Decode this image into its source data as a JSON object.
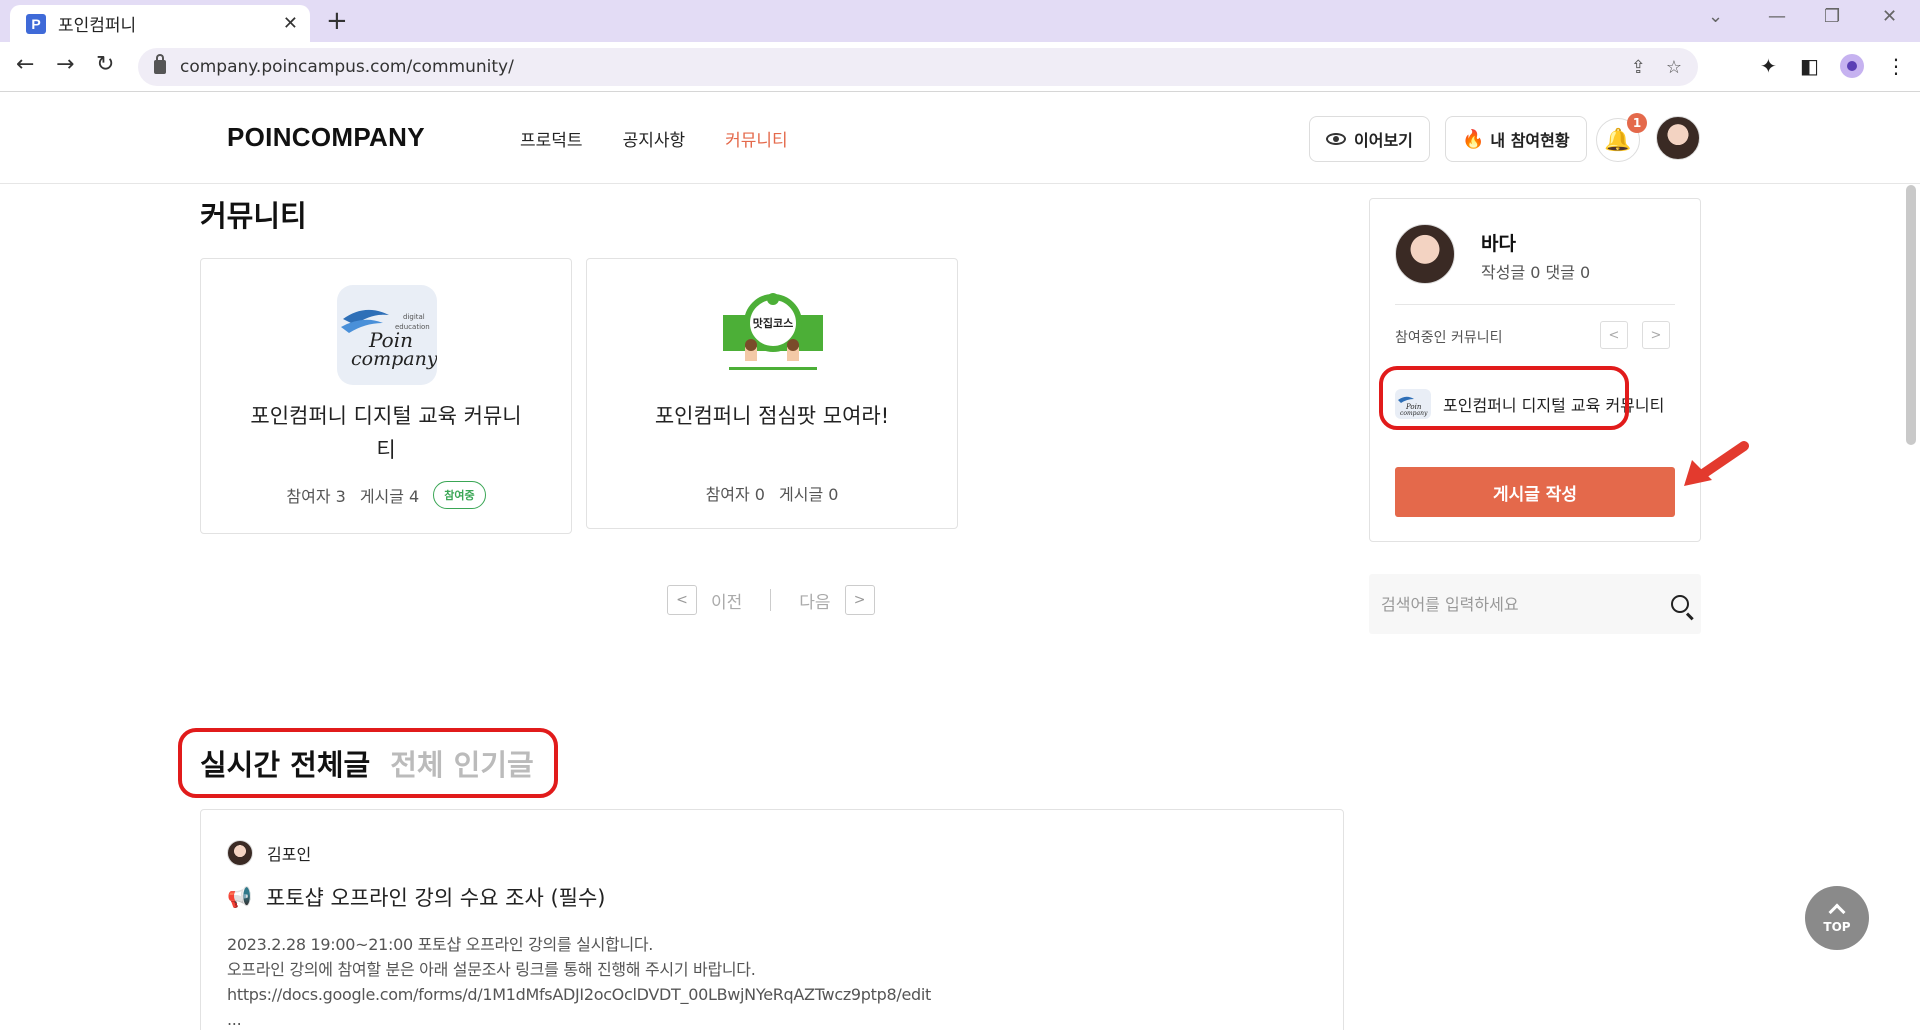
{
  "browser": {
    "tab_title": "포인컴퍼니",
    "favicon_letter": "P",
    "url": "company.poincampus.com/community/"
  },
  "header": {
    "logo": "POINCOMPANY",
    "nav": [
      "프로덕트",
      "공지사항",
      "커뮤니티"
    ],
    "active_nav": "커뮤니티",
    "continue_label": "이어보기",
    "participation_label": "내 참여현황",
    "notification_count": "1"
  },
  "main": {
    "title": "커뮤니티",
    "cards": [
      {
        "name": "포인컴퍼니 디지털 교육 커뮤니티",
        "participants": "참여자 3",
        "posts": "게시글 4",
        "badge": "참여중",
        "logo_text": "Poin company",
        "logo_sub": "digital education"
      },
      {
        "name": "포인컴퍼니 점심팟 모여라!",
        "participants": "참여자 0",
        "posts": "게시글 0",
        "logo_text": "맛집코스"
      }
    ],
    "pager": {
      "prev": "이전",
      "next": "다음"
    }
  },
  "sidebar": {
    "user_name": "바다",
    "user_stats": "작성글 0 댓글 0",
    "joined_label": "참여중인 커뮤니티",
    "joined_community": "포인컴퍼니 디지털 교육 커뮤니티",
    "write_button": "게시글 작성",
    "search_placeholder": "검색어를 입력하세요"
  },
  "feed": {
    "tabs": [
      "실시간 전체글",
      "전체 인기글"
    ],
    "post": {
      "author": "김포인",
      "title": "포토샵 오프라인 강의 수요 조사 (필수)",
      "lines": [
        "2023.2.28 19:00~21:00 포토샵 오프라인 강의를 실시합니다.",
        "오프라인 강의에 참여할 분은 아래 설문조사 링크를 통해 진행해 주시기 바랍니다.",
        "https://docs.google.com/forms/d/1M1dMfsADJI2ocOclDVDT_00LBwjNYeRqAZTwcz9ptp8/edit",
        "..."
      ]
    }
  },
  "top_button": "TOP",
  "colors": {
    "accent": "#e4694b",
    "highlight": "#e11b1b",
    "badge_green": "#3aa655",
    "tabstrip": "#e3dcf5"
  }
}
